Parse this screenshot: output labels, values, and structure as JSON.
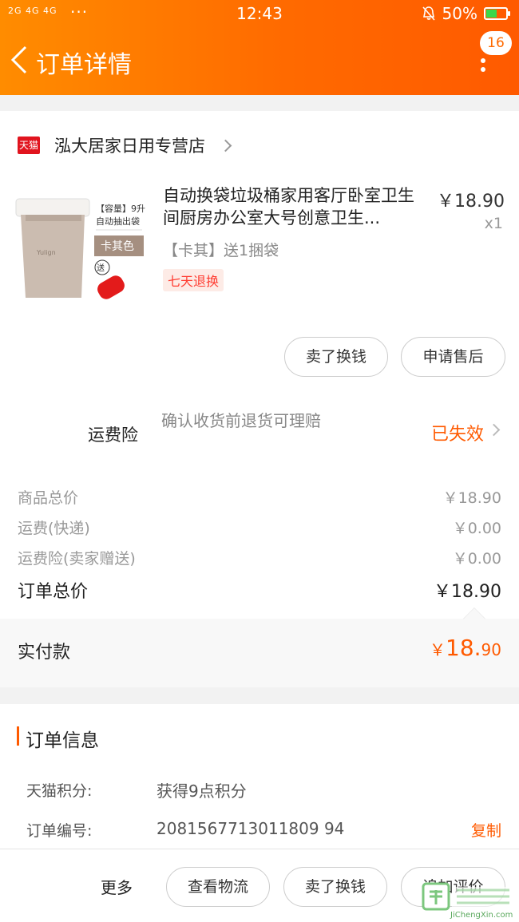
{
  "status_bar": {
    "signal": "2G 4G 4G",
    "dots": "···",
    "time": "12:43",
    "battery": "50%",
    "battery_level": 0.5
  },
  "header": {
    "title": "订单详情",
    "badge_count": "16",
    "bg_color": "#ff6a00"
  },
  "shop": {
    "platform_badge": "天猫",
    "name": "泓大居家日用专营店"
  },
  "product": {
    "image_texts": {
      "capacity": "【容量】9升",
      "subtitle": "自动抽出袋",
      "color_label": "卡其色",
      "gift": "送",
      "brand": "Yulign"
    },
    "title": "自动换袋垃圾桶家用客厅卧室卫生间厨房办公室大号创意卫生...",
    "price": "￥18.90",
    "quantity": "x1",
    "sku": "【卡其】送1捆袋",
    "tag": "七天退换"
  },
  "actions": {
    "exchange": "卖了换钱",
    "after_sale": "申请售后"
  },
  "insurance": {
    "label": "运费险",
    "description": "确认收货前退货可理赔",
    "status": "已失效"
  },
  "fees": {
    "goods_label": "商品总价",
    "goods_value": "￥18.90",
    "shipping_label": "运费(快递)",
    "shipping_value": "￥0.00",
    "insurance_label": "运费险(卖家赠送)",
    "insurance_value": "￥0.00",
    "total_label": "订单总价",
    "total_value": "￥18.90"
  },
  "paid": {
    "label": "实付款",
    "yen": "￥",
    "integer": "18.",
    "cents": "90"
  },
  "order_info": {
    "title": "订单信息",
    "points_label": "天猫积分:",
    "points_value": "获得9点积分",
    "number_label": "订单编号:",
    "number_value": "2081567713011809 94",
    "copy": "复制"
  },
  "bottom_bar": {
    "more": "更多",
    "logistics": "查看物流",
    "exchange": "卖了换钱",
    "review": "追加评价"
  },
  "watermark": {
    "text": "JiChengXin.com"
  },
  "colors": {
    "accent": "#ff5a00",
    "tmall_red": "#e1141e",
    "tag_red": "#ff3b30"
  }
}
